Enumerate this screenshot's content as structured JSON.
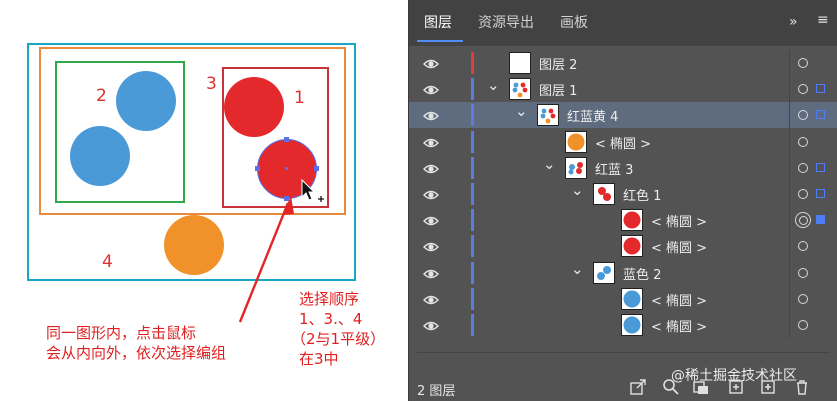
{
  "canvas": {
    "group_numbers": [
      "2",
      "3",
      "1",
      "4"
    ],
    "note_left": [
      "同一图形内，点击鼠标",
      "会从内向外，依次选择编组"
    ],
    "note_right": [
      "选择顺序",
      "1、3.、4",
      "（2与1平级）",
      "在3中"
    ],
    "colors": {
      "blue": "#4a9ad8",
      "red": "#e4292c",
      "orange": "#f0912a",
      "cyan_box": "#1aa7c6",
      "orange_box": "#e88b3c",
      "green_box": "#2ea84a",
      "red_box": "#c8323a"
    }
  },
  "panel": {
    "tabs": [
      {
        "label": "图层",
        "active": true
      },
      {
        "label": "资源导出",
        "active": false
      },
      {
        "label": "画板",
        "active": false
      }
    ],
    "overflow_glyph": "»",
    "menu_glyph": "≡",
    "layers": [
      {
        "label": "图层 2",
        "indent": 0,
        "expanded": false,
        "thumb": "blank",
        "line_color": "#e23c3c",
        "selected": false,
        "target": "single",
        "selsq": "none"
      },
      {
        "label": "图层 1",
        "indent": 0,
        "expanded": true,
        "thumb": "mixed",
        "line_color": "#5a7de0",
        "selected": false,
        "target": "single",
        "selsq": "outline"
      },
      {
        "label": "红蓝黄 4",
        "indent": 1,
        "expanded": true,
        "thumb": "mixed",
        "line_color": "#5a7de0",
        "selected": true,
        "target": "single",
        "selsq": "outline"
      },
      {
        "label": "< 椭圆 >",
        "indent": 2,
        "expanded": null,
        "thumb": "orange",
        "line_color": "#5a7de0",
        "selected": false,
        "target": "single",
        "selsq": "none"
      },
      {
        "label": "红蓝 3",
        "indent": 2,
        "expanded": true,
        "thumb": "redblue",
        "line_color": "#5a7de0",
        "selected": false,
        "target": "single",
        "selsq": "outline"
      },
      {
        "label": "红色 1",
        "indent": 3,
        "expanded": true,
        "thumb": "red2",
        "line_color": "#5a7de0",
        "selected": false,
        "target": "single",
        "selsq": "outline"
      },
      {
        "label": "< 椭圆 >",
        "indent": 4,
        "expanded": null,
        "thumb": "red",
        "line_color": "#5a7de0",
        "selected": false,
        "target": "double",
        "selsq": "filled"
      },
      {
        "label": "< 椭圆 >",
        "indent": 4,
        "expanded": null,
        "thumb": "red",
        "line_color": "#5a7de0",
        "selected": false,
        "target": "single",
        "selsq": "none"
      },
      {
        "label": "蓝色 2",
        "indent": 3,
        "expanded": true,
        "thumb": "blue2",
        "line_color": "#5a7de0",
        "selected": false,
        "target": "single",
        "selsq": "none"
      },
      {
        "label": "< 椭圆 >",
        "indent": 4,
        "expanded": null,
        "thumb": "blue",
        "line_color": "#5a7de0",
        "selected": false,
        "target": "single",
        "selsq": "none"
      },
      {
        "label": "< 椭圆 >",
        "indent": 4,
        "expanded": null,
        "thumb": "blue",
        "line_color": "#5a7de0",
        "selected": false,
        "target": "single",
        "selsq": "none"
      }
    ],
    "footer": {
      "count_label": "2 图层",
      "icons": [
        "export-icon",
        "search-icon",
        "collect-icon",
        "new-sublayer-icon",
        "new-layer-icon",
        "trash-icon"
      ]
    },
    "watermark": "@稀土掘金技术社区"
  }
}
